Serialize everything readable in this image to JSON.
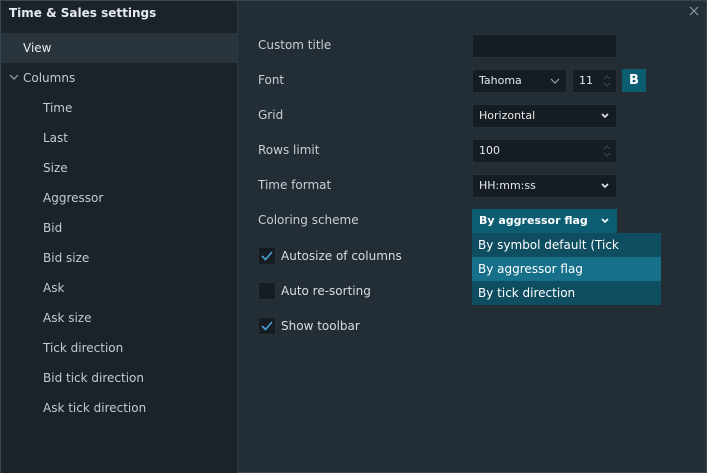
{
  "window": {
    "title": "Time & Sales settings"
  },
  "sidebar": {
    "items": [
      {
        "label": "View"
      },
      {
        "label": "Columns"
      },
      {
        "label": "Time"
      },
      {
        "label": "Last"
      },
      {
        "label": "Size"
      },
      {
        "label": "Aggressor"
      },
      {
        "label": "Bid"
      },
      {
        "label": "Bid size"
      },
      {
        "label": "Ask"
      },
      {
        "label": "Ask size"
      },
      {
        "label": "Tick direction"
      },
      {
        "label": "Bid tick direction"
      },
      {
        "label": "Ask tick direction"
      }
    ]
  },
  "form": {
    "custom_title": {
      "label": "Custom title",
      "value": ""
    },
    "font": {
      "label": "Font",
      "family": "Tahoma",
      "size": "11",
      "bold_label": "B"
    },
    "grid": {
      "label": "Grid",
      "value": "Horizontal"
    },
    "rows_limit": {
      "label": "Rows limit",
      "value": "100"
    },
    "time_format": {
      "label": "Time format",
      "value": "HH:mm:ss"
    },
    "coloring_scheme": {
      "label": "Coloring scheme",
      "value": "By aggressor flag",
      "options": [
        "By symbol default (Tick direction)",
        "By aggressor flag",
        "By tick direction"
      ]
    },
    "autosize_columns": {
      "label": "Autosize of columns",
      "checked": true
    },
    "auto_resorting": {
      "label": "Auto re-sorting",
      "checked": false
    },
    "show_toolbar": {
      "label": "Show toolbar",
      "checked": true
    }
  },
  "colors": {
    "accent": "#0c5d72",
    "highlight": "#17708a",
    "check": "#4aa3d8"
  }
}
